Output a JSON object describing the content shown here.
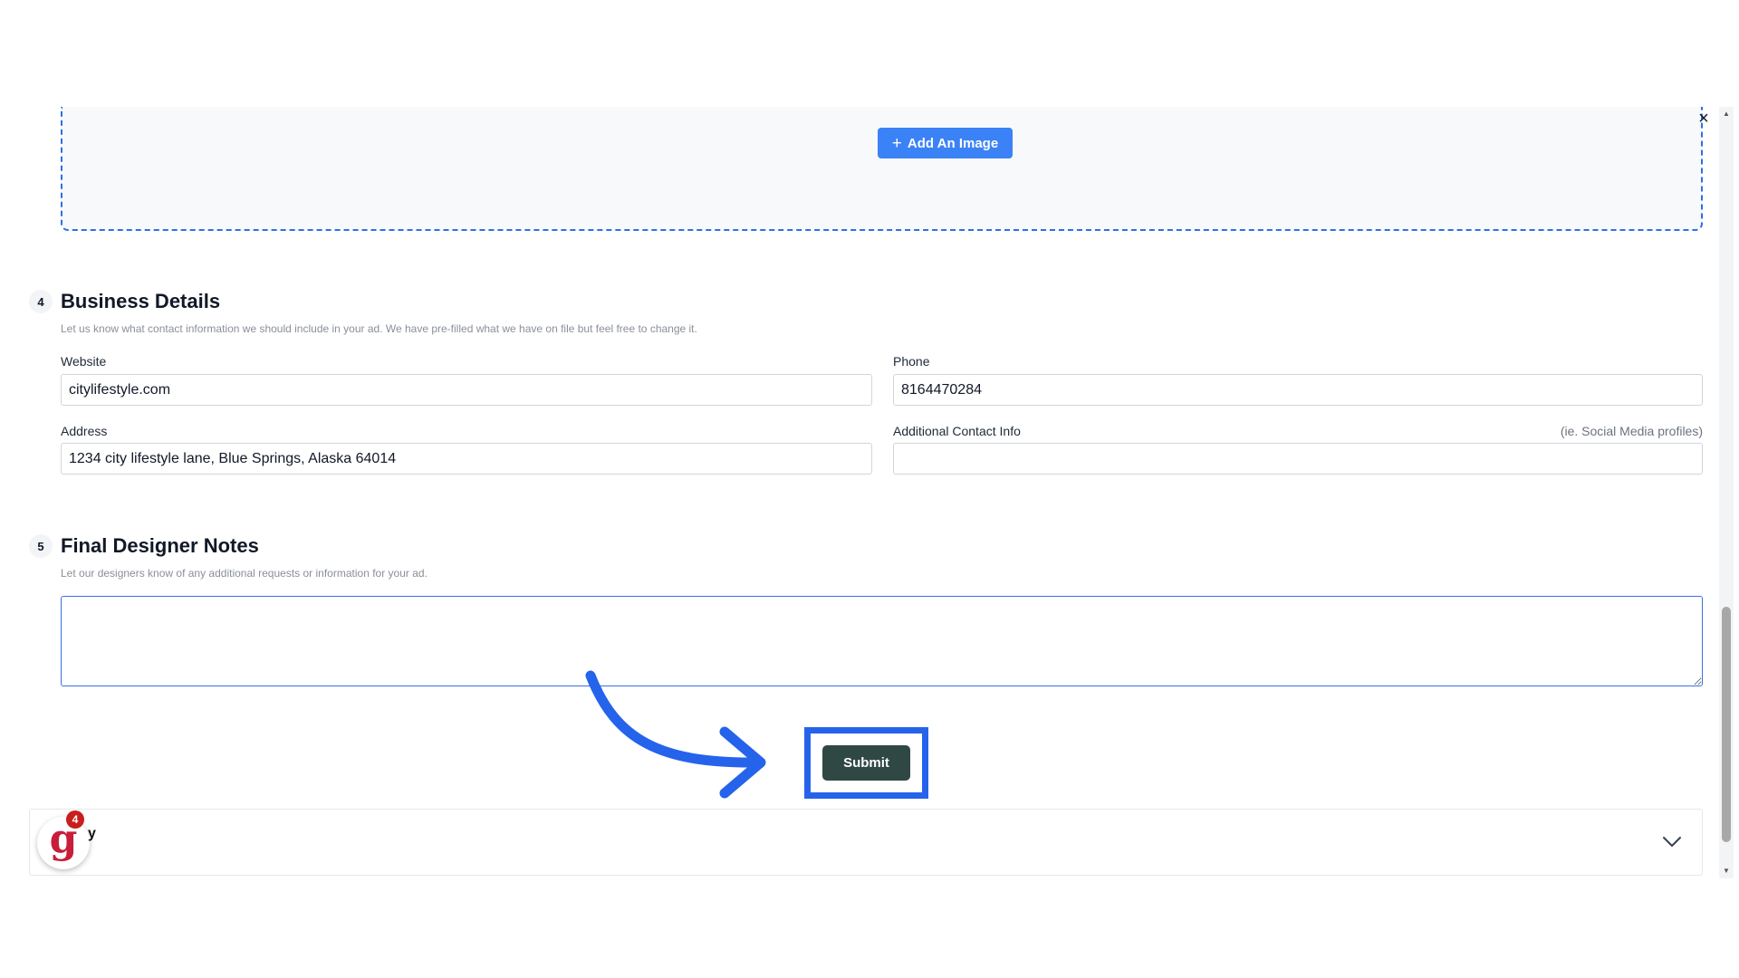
{
  "upload": {
    "add_image_label": "Add An Image",
    "close_symbol": "×"
  },
  "section4": {
    "number": "4",
    "title": "Business Details",
    "description": "Let us know what contact information we should include in your ad. We have pre-filled what we have on file but feel free to change it.",
    "website": {
      "label": "Website",
      "value": "citylifestyle.com"
    },
    "phone": {
      "label": "Phone",
      "value": "8164470284"
    },
    "address": {
      "label": "Address",
      "value": "1234 city lifestyle lane, Blue Springs, Alaska 64014"
    },
    "additional": {
      "label": "Additional Contact Info",
      "hint": "(ie. Social Media profiles)",
      "value": ""
    }
  },
  "section5": {
    "number": "5",
    "title": "Final Designer Notes",
    "description": "Let our designers know of any additional requests or information for your ad.",
    "notes_value": ""
  },
  "submit_label": "Submit",
  "chat": {
    "logo_letter": "g",
    "badge_count": "4",
    "logo_suffix": "y"
  },
  "icons": {
    "plus": "plus-icon",
    "close": "close-icon",
    "chevron": "chevron-down-icon",
    "arrow": "curved-arrow-icon"
  },
  "colors": {
    "primary_blue": "#3b82f6",
    "highlight_blue": "#2563eb",
    "submit_bg": "#2f4843",
    "badge_red": "#c81e1e"
  }
}
